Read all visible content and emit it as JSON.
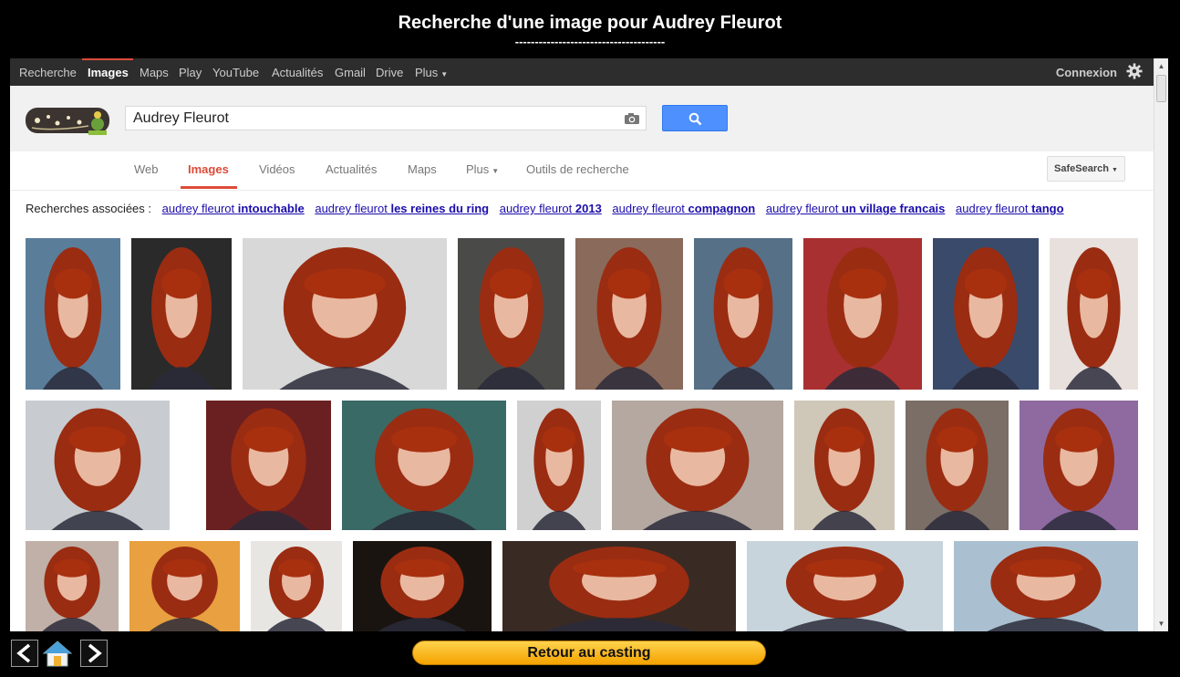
{
  "window": {
    "title": "Recherche d'une image pour Audrey Fleurot",
    "title_rule": "--------------------------------------"
  },
  "gbar": {
    "items": [
      "Recherche",
      "Images",
      "Maps",
      "Play",
      "YouTube",
      "Actualités",
      "Gmail",
      "Drive",
      "Plus"
    ],
    "active": "Images",
    "signin": "Connexion"
  },
  "search": {
    "query": "Audrey Fleurot",
    "camera_icon": "camera-icon",
    "search_icon": "magnifier-icon"
  },
  "tabs": {
    "items": [
      "Web",
      "Images",
      "Vidéos",
      "Actualités",
      "Maps",
      "Plus",
      "Outils de recherche"
    ],
    "active": "Images",
    "safesearch": "SafeSearch"
  },
  "related": {
    "label": "Recherches associées :",
    "items": [
      {
        "prefix": "audrey fleurot",
        "bold": "intouchable"
      },
      {
        "prefix": "audrey fleurot",
        "bold": "les reines du ring"
      },
      {
        "prefix": "audrey fleurot",
        "bold": "2013"
      },
      {
        "prefix": "audrey fleurot",
        "bold": "compagnon"
      },
      {
        "prefix": "audrey fleurot",
        "bold": "un village francais"
      },
      {
        "prefix": "audrey fleurot",
        "bold": "tango"
      }
    ]
  },
  "footer": {
    "back_icon": "arrow-left-icon",
    "home_icon": "home-icon",
    "forward_icon": "arrow-right-icon",
    "casting_button": "Retour au casting"
  },
  "colors": {
    "accent_red": "#dd4b39",
    "search_blue": "#4d90fe",
    "link_blue": "#1a0dab",
    "gbar_bg": "#2d2d2d",
    "casting_orange": "#f5a200"
  }
}
